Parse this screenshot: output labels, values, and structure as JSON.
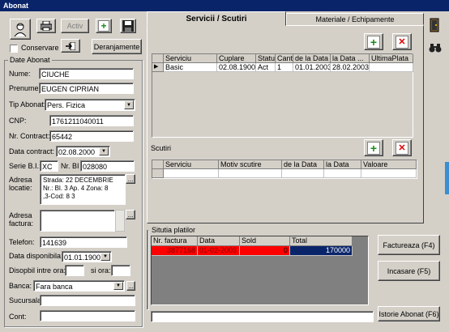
{
  "window": {
    "title": "Abonat"
  },
  "toolbar": {
    "activ_label": "Activ",
    "conservare_label": "Conservare",
    "deranjamente_label": "Deranjamente"
  },
  "date_abonat": {
    "group_title": "Date Abonat",
    "nume_label": "Nume:",
    "nume_value": "CIUCHE",
    "prenume_label": "Prenume:",
    "prenume_value": "EUGEN CIPRIAN",
    "tip_label": "Tip Abonat:",
    "tip_value": "Pers. Fizica",
    "cnp_label": "CNP:",
    "cnp_value": "1761211040011",
    "contract_label": "Nr. Contract:",
    "contract_value": "65442",
    "data_contract_label": "Data contract:",
    "data_contract_value": "02.08.2000",
    "serie_label": "Serie B.I.:",
    "serie_value": "XC",
    "nrbi_label": "Nr. BI",
    "nrbi_value": "028080",
    "adresa_locatie_label": "Adresa locatie:",
    "adresa_locatie_lines": [
      "Strada: 22 DECEMBRIE",
      "Nr.:  Bl. 3 Ap. 4 Zona: 8",
      ",3-Cod: 8  3"
    ],
    "adresa_factura_label": "Adresa factura:",
    "telefon_label": "Telefon:",
    "telefon_value": "141639",
    "data_disp_label": "Data disponibila:",
    "data_disp_value": "01.01.1900",
    "disp_intre_label": "Disopbil intre ora:",
    "si_ora_label": "si ora:",
    "banca_label": "Banca:",
    "banca_value": "Fara banca",
    "sucursala_label": "Sucursala",
    "cont_label": "Cont:"
  },
  "tabs": [
    {
      "label": "Servicii / Scutiri",
      "active": true
    },
    {
      "label": "Materiale / Echipamente",
      "active": false
    }
  ],
  "servicii": {
    "columns": [
      "Serviciu",
      "Cuplare",
      "Status",
      "Cant",
      "de la Data",
      "la Data ...",
      "UltimaPlata"
    ],
    "rows": [
      [
        "Basic",
        "02.08.1900",
        "Act",
        "1",
        "01.01.2003",
        "28.02.2003",
        ""
      ]
    ]
  },
  "scutiri": {
    "title": "Scutiri",
    "columns": [
      "Serviciu",
      "Motiv scutire",
      "de la Data",
      "la Data",
      "Valoare"
    ]
  },
  "plati": {
    "group_title": "Situtia platilor",
    "columns": [
      "Nr. factura",
      "Data",
      "Sold",
      "Total"
    ],
    "rows": [
      [
        "3877168",
        "01-02-2003",
        "0",
        "170000"
      ]
    ]
  },
  "buttons": {
    "factureaza": "Factureaza (F4)",
    "incasare": "Incasare (F5)",
    "istorie": "Istorie Abonat (F6)"
  },
  "colors": {
    "titlebar": "#0a246a",
    "row_red": "#ff0000",
    "row_blue": "#0a246a",
    "green": "#1b8a1b"
  }
}
